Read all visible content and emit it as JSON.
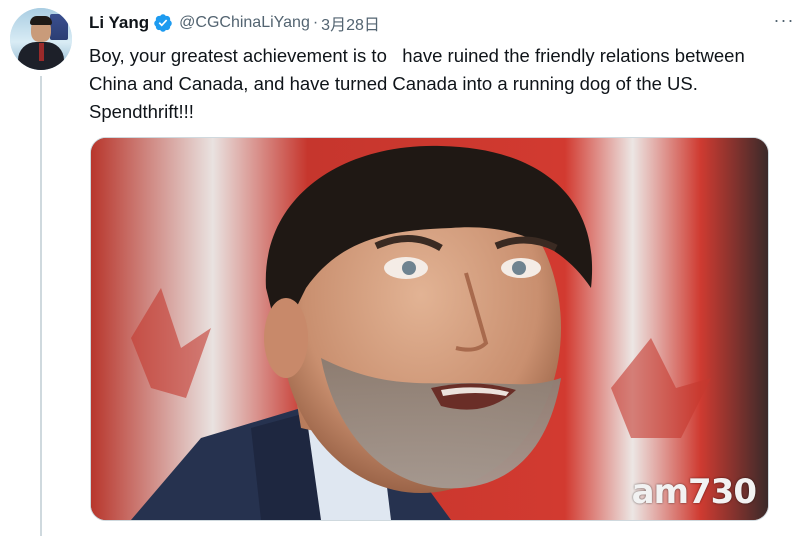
{
  "tweet": {
    "author_name": "Li Yang",
    "handle": "@CGChinaLiYang",
    "separator": "·",
    "date": "3月28日",
    "more_label": "···",
    "text": "Boy, your greatest achievement is to   have ruined the friendly relations between China and Canada, and have turned Canada into a running dog of the US. Spendthrift!!!"
  },
  "media": {
    "watermark": "am730"
  },
  "icons": {
    "verified": "verified-badge-icon",
    "more": "more-icon"
  },
  "colors": {
    "verified": "#1d9bf0",
    "secondary_text": "#536471",
    "primary_text": "#0f1419"
  }
}
